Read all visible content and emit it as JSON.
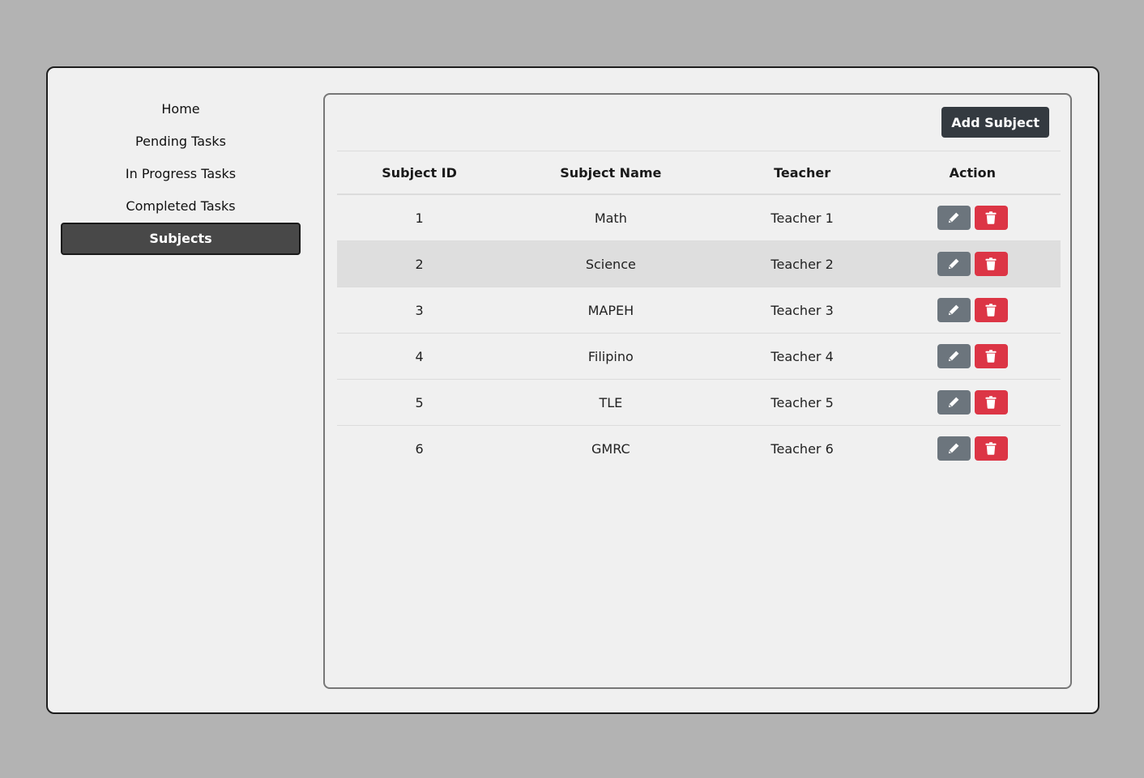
{
  "sidebar": {
    "items": [
      {
        "label": "Home"
      },
      {
        "label": "Pending Tasks"
      },
      {
        "label": "In Progress Tasks"
      },
      {
        "label": "Completed Tasks"
      },
      {
        "label": "Subjects",
        "active": true
      }
    ]
  },
  "toolbar": {
    "add_label": "Add Subject"
  },
  "table": {
    "headers": [
      "Subject ID",
      "Subject Name",
      "Teacher",
      "Action"
    ],
    "rows": [
      {
        "id": "1",
        "name": "Math",
        "teacher": "Teacher 1"
      },
      {
        "id": "2",
        "name": "Science",
        "teacher": "Teacher 2"
      },
      {
        "id": "3",
        "name": "MAPEH",
        "teacher": "Teacher 3"
      },
      {
        "id": "4",
        "name": "Filipino",
        "teacher": "Teacher 4"
      },
      {
        "id": "5",
        "name": "TLE",
        "teacher": "Teacher 5"
      },
      {
        "id": "6",
        "name": "GMRC",
        "teacher": "Teacher 6"
      }
    ],
    "row_actions": [
      {
        "name": "edit",
        "icon": "pencil-icon",
        "color": "#6c757d"
      },
      {
        "name": "delete",
        "icon": "trash-icon",
        "color": "#dc3545"
      }
    ]
  },
  "colors": {
    "page_background": "#b3b3b3",
    "window_background": "#f0f0f0",
    "active_nav": "#484848",
    "primary_button": "#343a40",
    "highlight_row": "#dedede"
  }
}
